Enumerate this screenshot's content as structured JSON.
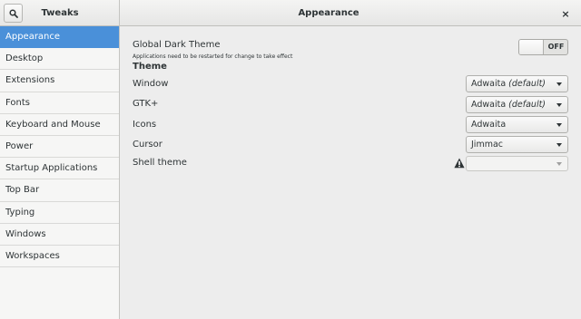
{
  "header": {
    "app_title": "Tweaks",
    "page_title": "Appearance",
    "close_label": "×"
  },
  "sidebar": {
    "items": [
      {
        "label": "Appearance",
        "active": true
      },
      {
        "label": "Desktop"
      },
      {
        "label": "Extensions"
      },
      {
        "label": "Fonts"
      },
      {
        "label": "Keyboard and Mouse"
      },
      {
        "label": "Power"
      },
      {
        "label": "Startup Applications"
      },
      {
        "label": "Top Bar"
      },
      {
        "label": "Typing"
      },
      {
        "label": "Windows"
      },
      {
        "label": "Workspaces"
      }
    ]
  },
  "main": {
    "dark_theme": {
      "label": "Global Dark Theme",
      "note": "Applications need to be restarted for change to take effect",
      "toggle_label": "OFF",
      "state": "off"
    },
    "theme_section": "Theme",
    "rows": {
      "window": {
        "label": "Window",
        "value": "Adwaita",
        "suffix": "(default)"
      },
      "gtk": {
        "label": "GTK+",
        "value": "Adwaita",
        "suffix": "(default)"
      },
      "icons": {
        "label": "Icons",
        "value": "Adwaita",
        "suffix": ""
      },
      "cursor": {
        "label": "Cursor",
        "value": "Jimmac",
        "suffix": ""
      },
      "shell": {
        "label": "Shell theme",
        "value": "",
        "suffix": "",
        "disabled": true,
        "warning": "warning-icon"
      }
    }
  },
  "colors": {
    "accent": "#4a90d9",
    "background": "#ededed",
    "sidebar": "#f6f6f5",
    "text": "#2e3436"
  }
}
